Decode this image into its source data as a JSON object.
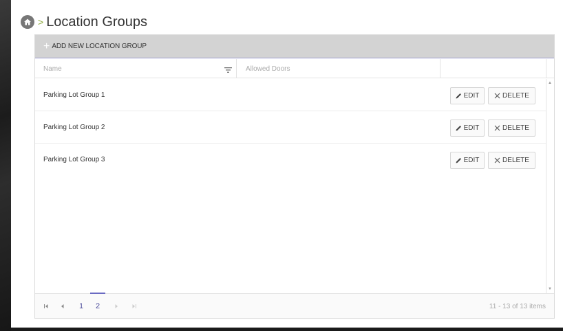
{
  "page": {
    "title": "Location Groups",
    "breadcrumb_separator": ">",
    "home_icon": "home-icon"
  },
  "toolbar": {
    "add_icon": "plus-icon",
    "add_label": "ADD NEW LOCATION GROUP"
  },
  "columns": {
    "name": "Name",
    "allowed_doors": "Allowed Doors",
    "filter_icon": "filter-icon"
  },
  "rows": [
    {
      "name": "Parking Lot Group 1",
      "edit_label": "EDIT",
      "delete_label": "DELETE"
    },
    {
      "name": "Parking Lot Group 2",
      "edit_label": "EDIT",
      "delete_label": "DELETE"
    },
    {
      "name": "Parking Lot Group 3",
      "edit_label": "EDIT",
      "delete_label": "DELETE"
    }
  ],
  "pager": {
    "pages": [
      "1",
      "2"
    ],
    "current_page": "2",
    "info": "11 - 13 of 13 items"
  },
  "colors": {
    "accent": "#6a6ac2",
    "breadcrumb_separator": "#8aa838",
    "toolbar_bg": "#d3d3d3"
  }
}
